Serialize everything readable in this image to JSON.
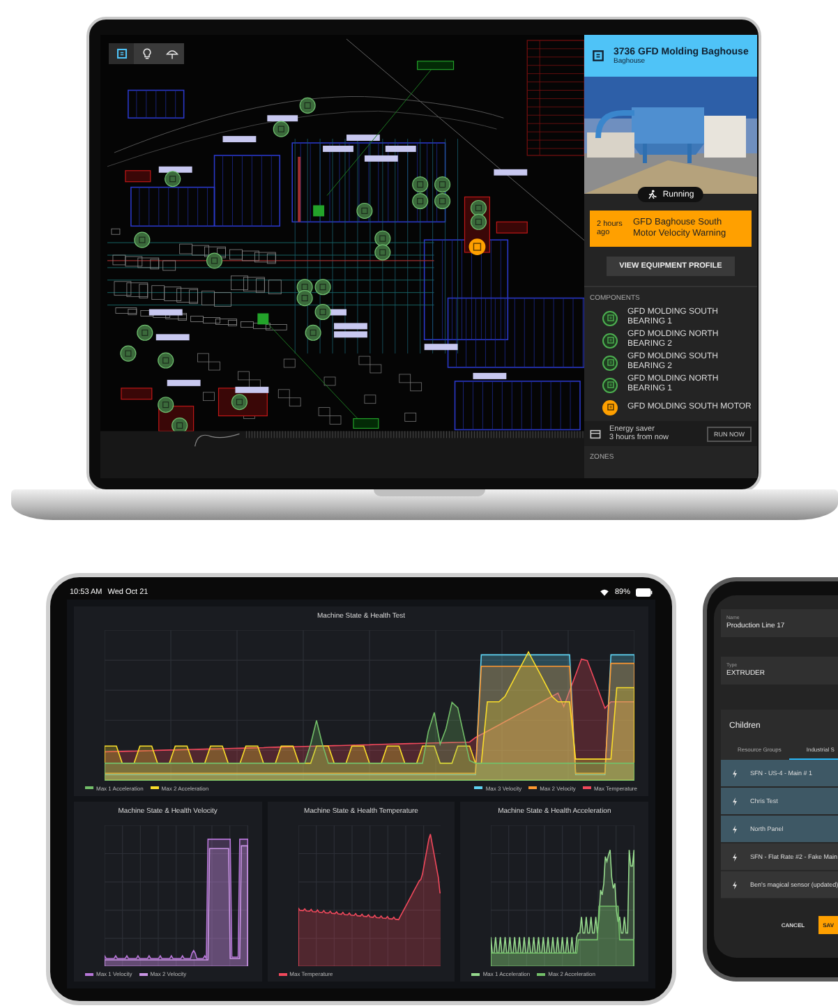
{
  "laptop": {
    "map_tools": [
      {
        "kind": "layers",
        "selected": true
      },
      {
        "kind": "bulb",
        "selected": false
      },
      {
        "kind": "tree",
        "selected": false
      }
    ],
    "equipment_panel": {
      "title": "3736 GFD Molding Baghouse",
      "subtitle": "Baghouse",
      "status": "Running",
      "alert": {
        "time": "2 hours ago",
        "message": "GFD Baghouse South Motor Velocity Warning"
      },
      "button": "VIEW EQUIPMENT PROFILE",
      "components_heading": "COMPONENTS",
      "components": [
        {
          "name": "GFD MOLDING SOUTH BEARING 1",
          "color": "#4caf50"
        },
        {
          "name": "GFD MOLDING NORTH BEARING 2",
          "color": "#4caf50"
        },
        {
          "name": "GFD MOLDING SOUTH BEARING 2",
          "color": "#4caf50"
        },
        {
          "name": "GFD MOLDING NORTH BEARING 1",
          "color": "#4caf50"
        },
        {
          "name": "GFD MOLDING SOUTH MOTOR",
          "color": "#ffa000"
        }
      ],
      "schedule": {
        "title": "Energy saver",
        "time": "3 hours from now",
        "action": "RUN NOW"
      },
      "zones_heading": "ZONES"
    }
  },
  "tablet": {
    "status_bar": {
      "time": "10:53 AM",
      "date": "Wed Oct 21",
      "battery": "89%"
    },
    "panels": [
      {
        "kind": "combined",
        "title": "Machine State & Health Test",
        "legend_left": [
          {
            "name": "Max 1 Acceleration",
            "color": "#73bf69"
          },
          {
            "name": "Max 2 Acceleration",
            "color": "#fade2a"
          }
        ],
        "legend_right": [
          {
            "name": "Max 3 Velocity",
            "color": "#5fd3f3"
          },
          {
            "name": "Max 2 Velocity",
            "color": "#ff9830"
          },
          {
            "name": "Max Temperature",
            "color": "#f2495c"
          }
        ]
      },
      {
        "kind": "velocity",
        "title": "Machine State & Health Velocity",
        "legend_left": [
          {
            "name": "Max 1 Velocity",
            "color": "#b877d9"
          },
          {
            "name": "Max 2 Velocity",
            "color": "#ca95e5"
          }
        ]
      },
      {
        "kind": "temperature",
        "title": "Machine State & Health Temperature",
        "legend_left": [
          {
            "name": "Max Temperature",
            "color": "#f2495c"
          }
        ]
      },
      {
        "kind": "acceleration",
        "title": "Machine State & Health Acceleration",
        "legend_left": [
          {
            "name": "Max 1 Acceleration",
            "color": "#96d98d"
          },
          {
            "name": "Max 2 Acceleration",
            "color": "#73bf69"
          }
        ]
      }
    ]
  },
  "phone": {
    "fields": [
      {
        "label": "Name",
        "value": "Production Line 17"
      },
      {
        "label": "Type",
        "value": "EXTRUDER"
      }
    ],
    "children": {
      "title": "Children",
      "tabs": [
        {
          "label": "Resource Groups",
          "selected": false
        },
        {
          "label": "Industrial S",
          "selected": true
        }
      ],
      "rows": [
        {
          "name": "SFN - US-4 - Main # 1",
          "selected": true
        },
        {
          "name": "Chris Test",
          "selected": true
        },
        {
          "name": "North Panel",
          "selected": true
        },
        {
          "name": "SFN - Flat Rate #2 - Fake Main",
          "selected": false
        },
        {
          "name": "Ben's magical sensor (updated)",
          "selected": false
        }
      ]
    },
    "buttons": [
      {
        "label": "CANCEL",
        "kind": "text"
      },
      {
        "label": "SAV",
        "kind": "primary"
      }
    ]
  }
}
